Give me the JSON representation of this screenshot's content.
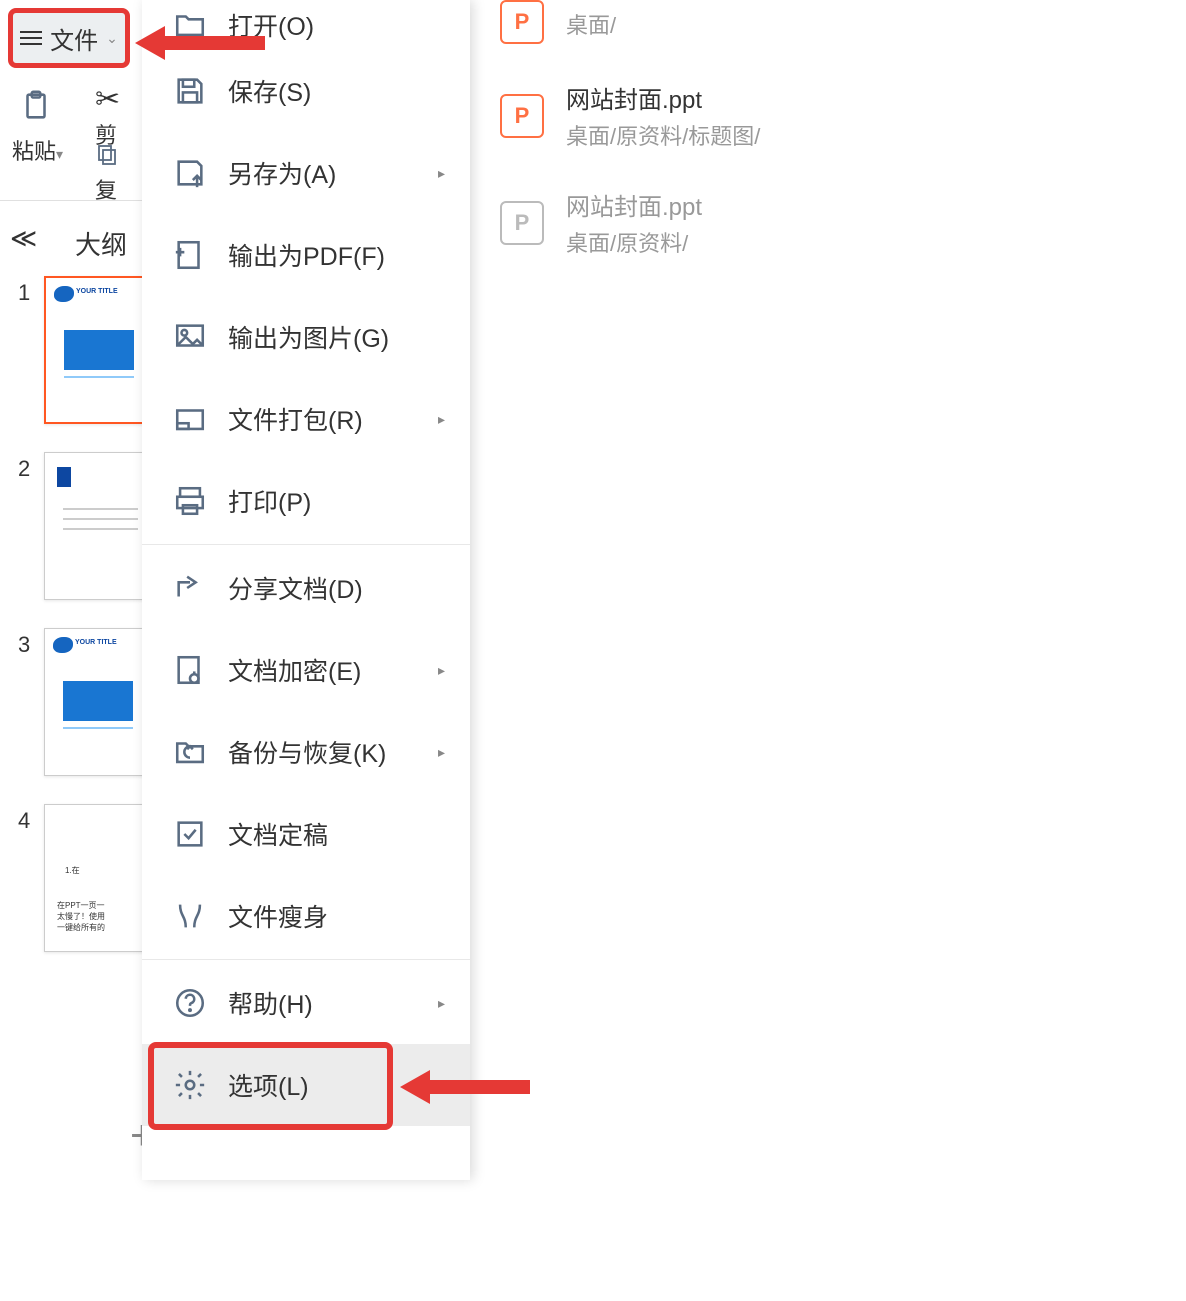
{
  "toolbar": {
    "file_label": "文件",
    "paste_label": "粘贴",
    "cut_label": "剪",
    "copy_label": "复"
  },
  "sidebar": {
    "outline_label": "大纲",
    "thumbnails": [
      {
        "num": "1",
        "title": "YOUR TITLE",
        "selected": true,
        "type": "title"
      },
      {
        "num": "2",
        "title": "",
        "selected": false,
        "type": "text"
      },
      {
        "num": "3",
        "title": "YOUR TITLE",
        "selected": false,
        "type": "title"
      },
      {
        "num": "4",
        "title": "",
        "selected": false,
        "type": "content"
      }
    ]
  },
  "menu": {
    "items": [
      {
        "label": "打开(O)",
        "icon": "folder",
        "arrow": false
      },
      {
        "label": "保存(S)",
        "icon": "save",
        "arrow": false
      },
      {
        "label": "另存为(A)",
        "icon": "saveas",
        "arrow": true
      },
      {
        "label": "输出为PDF(F)",
        "icon": "pdf",
        "arrow": false
      },
      {
        "label": "输出为图片(G)",
        "icon": "image",
        "arrow": false
      },
      {
        "label": "文件打包(R)",
        "icon": "package",
        "arrow": true
      },
      {
        "label": "打印(P)",
        "icon": "print",
        "arrow": false
      },
      {
        "label": "分享文档(D)",
        "icon": "share",
        "arrow": false
      },
      {
        "label": "文档加密(E)",
        "icon": "encrypt",
        "arrow": true
      },
      {
        "label": "备份与恢复(K)",
        "icon": "backup",
        "arrow": true
      },
      {
        "label": "文档定稿",
        "icon": "finalize",
        "arrow": false
      },
      {
        "label": "文件瘦身",
        "icon": "slim",
        "arrow": false
      },
      {
        "label": "帮助(H)",
        "icon": "help",
        "arrow": true
      },
      {
        "label": "选项(L)",
        "icon": "settings",
        "arrow": false,
        "highlighted": true
      }
    ]
  },
  "recent": {
    "items": [
      {
        "name": "",
        "path": "桌面/",
        "faded": false
      },
      {
        "name": "网站封面.ppt",
        "path": "桌面/原资料/标题图/",
        "faded": false
      },
      {
        "name": "网站封面.ppt",
        "path": "桌面/原资料/",
        "faded": true
      }
    ]
  },
  "thumb_content": {
    "t4_line1": "1.在",
    "t4_line2": "在PPT一页一",
    "t4_line3": "太慢了！使用",
    "t4_line4": "一键给所有的"
  }
}
